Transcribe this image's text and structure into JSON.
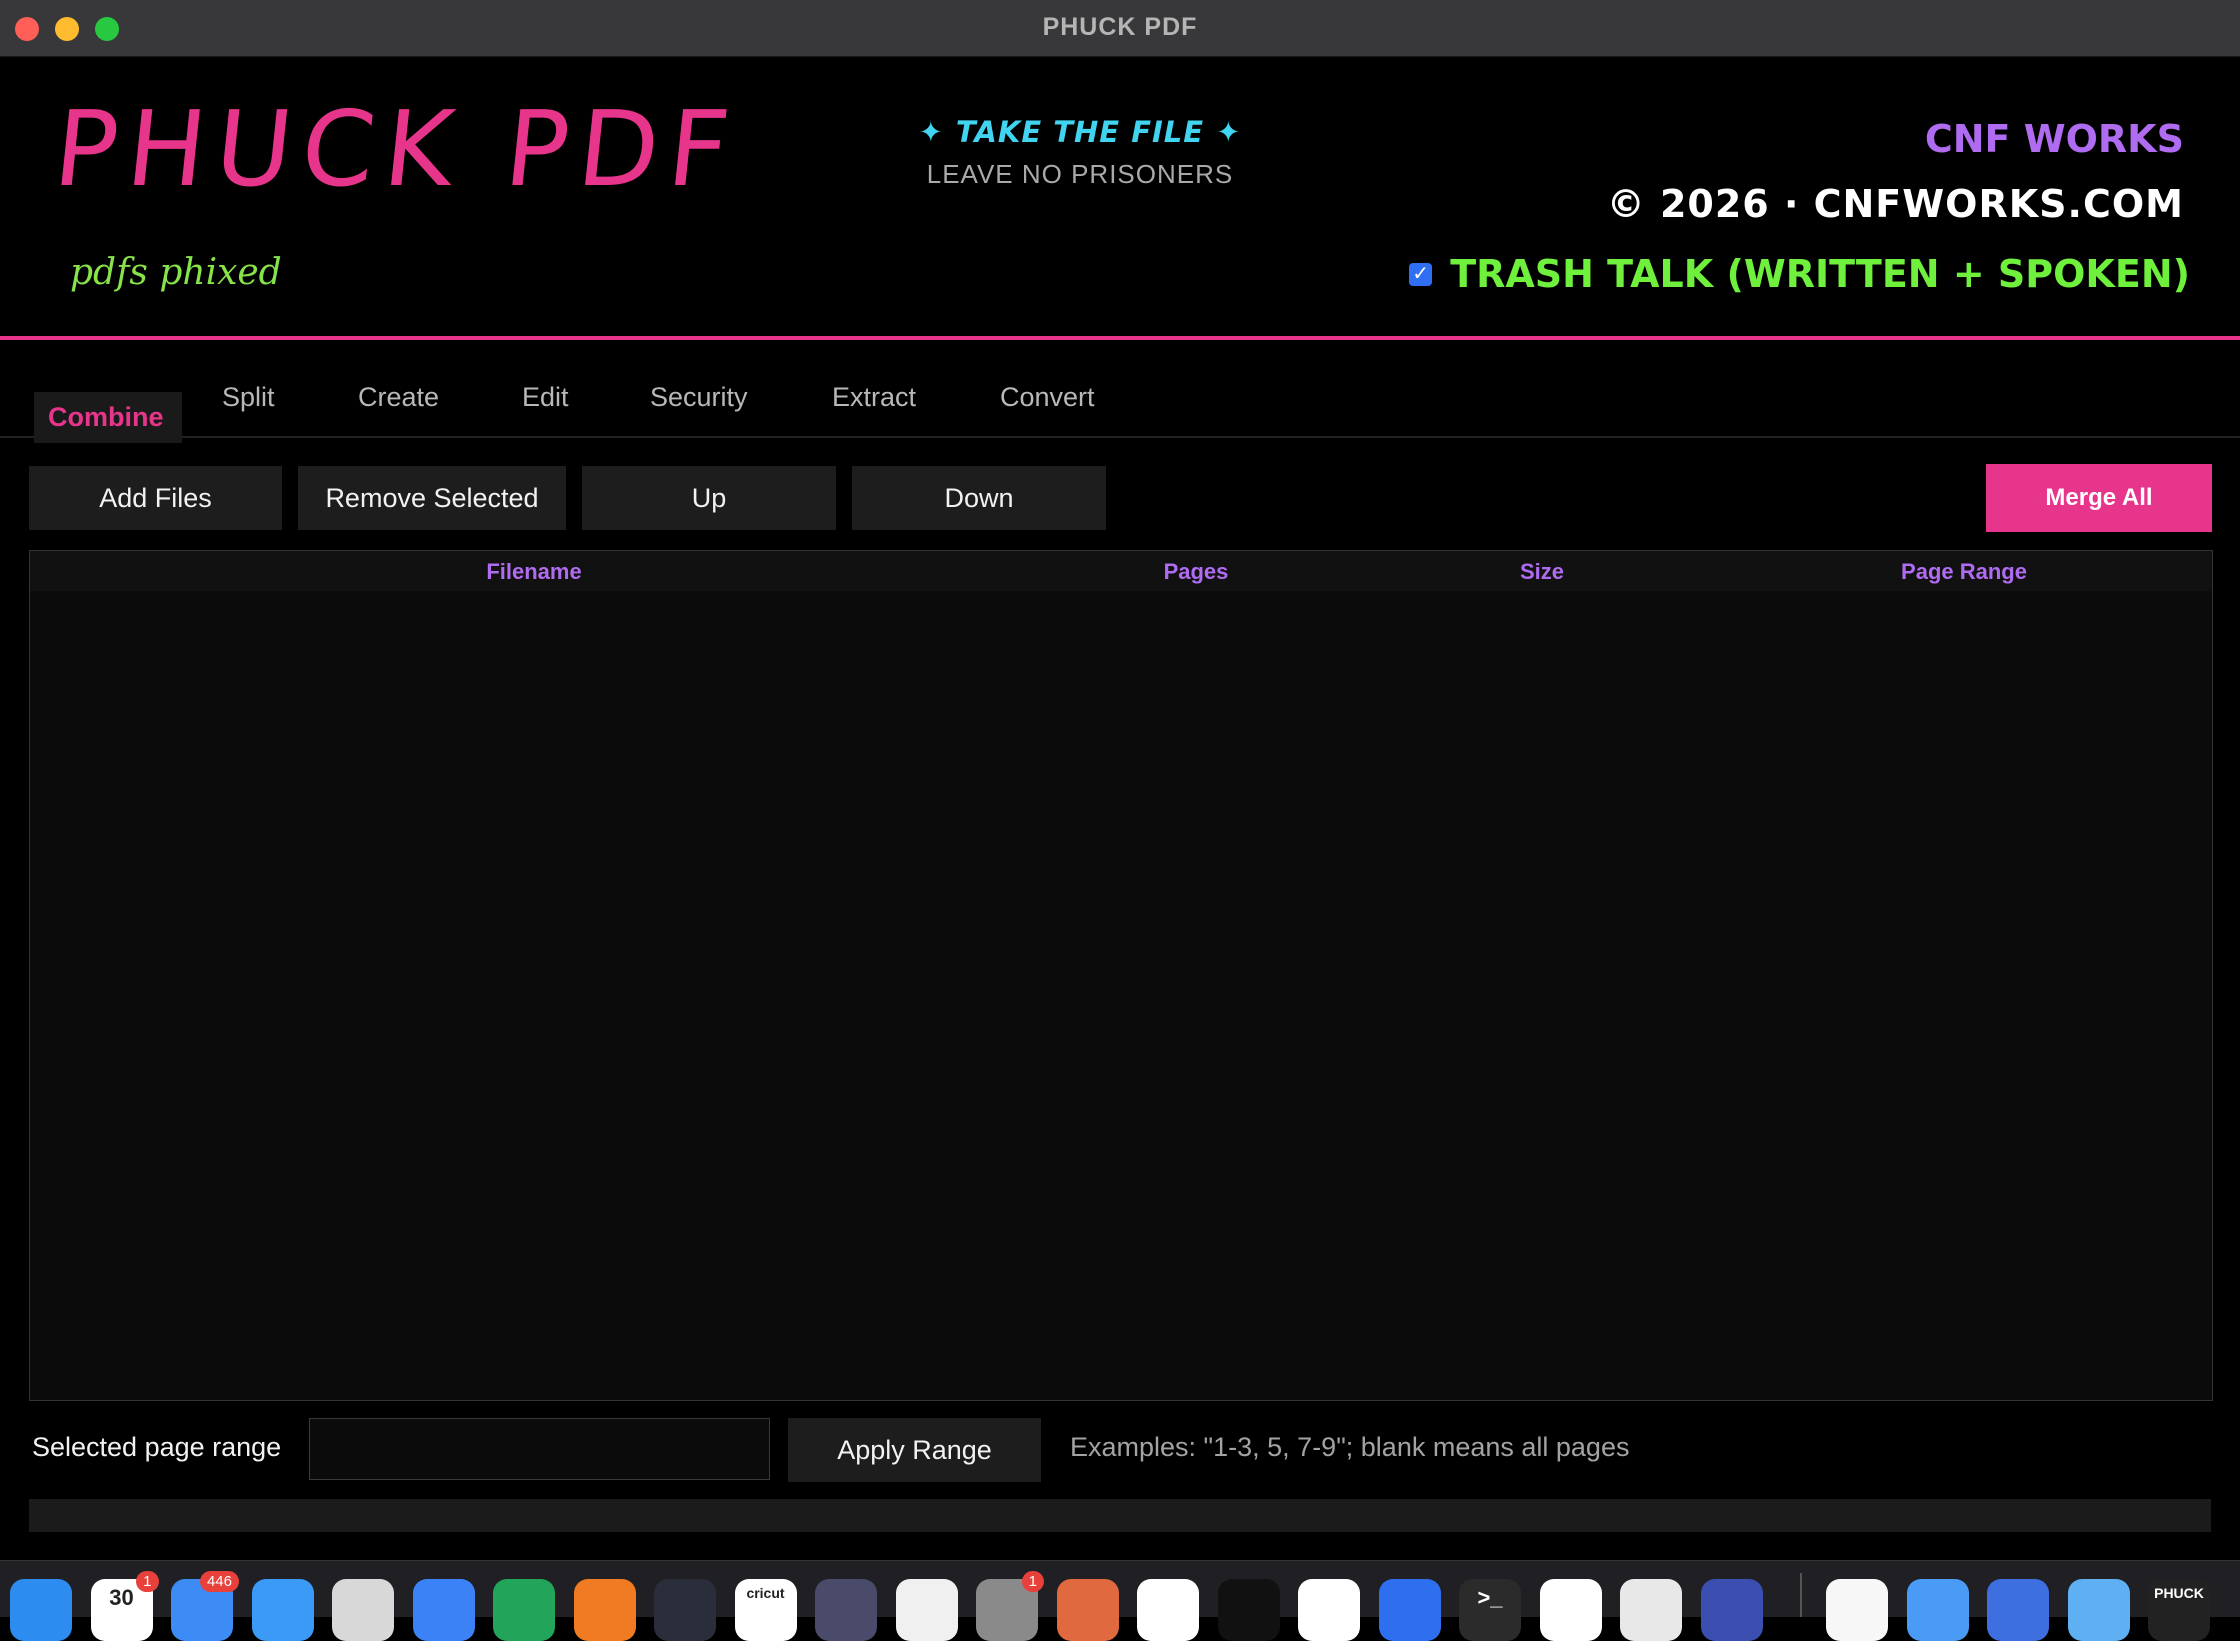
{
  "window": {
    "title": "PHUCK PDF"
  },
  "header": {
    "logo": "PHUCK PDF",
    "tagline": "pdfs phixed",
    "slogan_top": "TAKE THE FILE",
    "slogan_bottom": "LEAVE NO PRISONERS",
    "brand": "CNF WORKS",
    "copyright": "© 2026 · CNFWORKS.COM",
    "trash_talk_label": "TRASH TALK (WRITTEN + SPOKEN)",
    "trash_talk_checked": true
  },
  "tabs": [
    {
      "label": "Combine",
      "active": true
    },
    {
      "label": "Split"
    },
    {
      "label": "Create"
    },
    {
      "label": "Edit"
    },
    {
      "label": "Security"
    },
    {
      "label": "Extract"
    },
    {
      "label": "Convert"
    }
  ],
  "toolbar": {
    "add_files": "Add Files",
    "remove_selected": "Remove Selected",
    "up": "Up",
    "down": "Down",
    "merge_all": "Merge All"
  },
  "table": {
    "columns": [
      "Filename",
      "Pages",
      "Size",
      "Page Range"
    ],
    "rows": []
  },
  "range": {
    "label": "Selected page range",
    "value": "",
    "apply": "Apply Range",
    "examples": "Examples: \"1-3, 5, 7-9\"; blank means all pages"
  },
  "colors": {
    "accent_pink": "#e8358c",
    "accent_purple": "#b06cf0",
    "accent_green": "#6ef03c",
    "accent_cyan": "#40d4f0"
  },
  "dock": {
    "items": [
      {
        "icon": "finder-icon",
        "color": "#2d8cf0"
      },
      {
        "icon": "calendar-icon",
        "color": "#ffffff",
        "label": "30",
        "badge": "1"
      },
      {
        "icon": "mail-icon",
        "color": "#3d8bf5",
        "badge": "446"
      },
      {
        "icon": "safari-icon",
        "color": "#3a9af5"
      },
      {
        "icon": "script-editor-icon",
        "color": "#d8d8d8"
      },
      {
        "icon": "docs-icon",
        "color": "#3b82f6"
      },
      {
        "icon": "sheets-icon",
        "color": "#22a55b"
      },
      {
        "icon": "pages-icon",
        "color": "#f07b22"
      },
      {
        "icon": "vscode-icon",
        "color": "#2a2d3a"
      },
      {
        "icon": "cricut-icon",
        "color": "#ffffff",
        "label": "cricut"
      },
      {
        "icon": "keys-icon",
        "color": "#4a4a6a"
      },
      {
        "icon": "grid-app-icon",
        "color": "#f0f0f0"
      },
      {
        "icon": "system-settings-icon",
        "color": "#8a8a8a",
        "badge": "1"
      },
      {
        "icon": "claude-icon",
        "color": "#e0693f"
      },
      {
        "icon": "gemini-icon",
        "color": "#ffffff"
      },
      {
        "icon": "perplexity-icon",
        "color": "#111111"
      },
      {
        "icon": "chatgpt-icon",
        "color": "#ffffff"
      },
      {
        "icon": "messenger-icon",
        "color": "#2e6ff0"
      },
      {
        "icon": "terminal-icon",
        "color": "#2b2b2b",
        "label": ">_"
      },
      {
        "icon": "github-icon",
        "color": "#ffffff"
      },
      {
        "icon": "ollama-icon",
        "color": "#e8e8e8"
      },
      {
        "icon": "cloud-app-icon",
        "color": "#3a4fb0"
      },
      {
        "icon": "notes-icon",
        "color": "#f7f7f7"
      },
      {
        "icon": "disk-icon",
        "color": "#4a9bf5"
      },
      {
        "icon": "word-icon",
        "color": "#3d6fe0"
      },
      {
        "icon": "folder-icon",
        "color": "#5fb0f2"
      },
      {
        "icon": "phuck-pdf-icon",
        "color": "#222222",
        "label": "PHUCK"
      }
    ]
  }
}
